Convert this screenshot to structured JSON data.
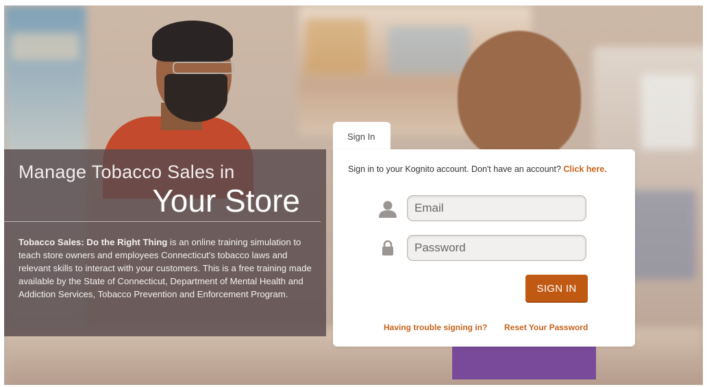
{
  "hero": {
    "title_line1": "Manage Tobacco Sales in",
    "title_line2": "Your Store",
    "body_bold": "Tobacco Sales: Do the Right Thing",
    "body_text": " is an online training simulation to teach store owners and employees Connecticut's tobacco laws and relevant skills to interact with your customers. This is a free training made available by the State of Connecticut, Department of Mental Health and Addiction Services, Tobacco Prevention and Enforcement Program."
  },
  "signin": {
    "tab_label": "Sign In",
    "prompt": "Sign in to your Kognito account. Don't have an account? ",
    "click_here": "Click here.",
    "email_placeholder": "Email",
    "password_placeholder": "Password",
    "button_label": "SIGN IN",
    "trouble_link": "Having trouble signing in?",
    "reset_link": "Reset Your Password",
    "email_icon": "user-icon",
    "password_icon": "lock-icon"
  },
  "colors": {
    "accent": "#c05a12",
    "link": "#c8631b",
    "overlay": "#594a4d"
  }
}
